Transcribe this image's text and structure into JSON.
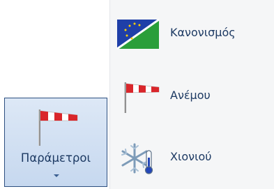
{
  "ribbon_button": {
    "label": "Παράμετροι",
    "icon": "windsock-icon"
  },
  "menu": {
    "items": [
      {
        "label": "Κανονισμός",
        "icon": "regulation-flag-icon"
      },
      {
        "label": "Ανέμου",
        "icon": "windsock-icon"
      },
      {
        "label": "Χιονιού",
        "icon": "snowflake-thermometer-icon"
      }
    ]
  }
}
